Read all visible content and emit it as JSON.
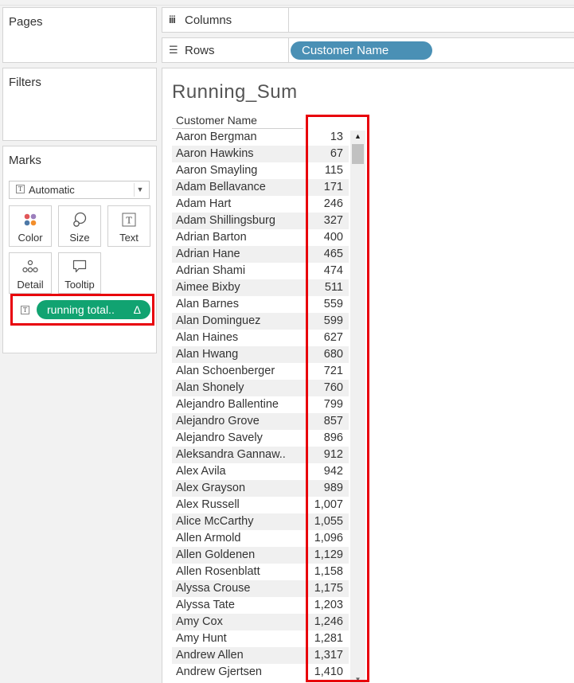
{
  "cards": {
    "pages_title": "Pages",
    "filters_title": "Filters",
    "marks_title": "Marks"
  },
  "marks": {
    "mark_type": "Automatic",
    "buttons": {
      "color": "Color",
      "size": "Size",
      "text": "Text",
      "detail": "Detail",
      "tooltip": "Tooltip"
    },
    "pill_label": "running total..",
    "pill_delta": "Δ"
  },
  "shelves": {
    "columns_label": "Columns",
    "rows_label": "Rows",
    "rows_pill": "Customer Name"
  },
  "view": {
    "title": "Running_Sum",
    "column_header": "Customer Name",
    "rows": [
      {
        "name": "Aaron Bergman",
        "value": "13"
      },
      {
        "name": "Aaron Hawkins",
        "value": "67"
      },
      {
        "name": "Aaron Smayling",
        "value": "115"
      },
      {
        "name": "Adam Bellavance",
        "value": "171"
      },
      {
        "name": "Adam Hart",
        "value": "246"
      },
      {
        "name": "Adam Shillingsburg",
        "value": "327"
      },
      {
        "name": "Adrian Barton",
        "value": "400"
      },
      {
        "name": "Adrian Hane",
        "value": "465"
      },
      {
        "name": "Adrian Shami",
        "value": "474"
      },
      {
        "name": "Aimee Bixby",
        "value": "511"
      },
      {
        "name": "Alan Barnes",
        "value": "559"
      },
      {
        "name": "Alan Dominguez",
        "value": "599"
      },
      {
        "name": "Alan Haines",
        "value": "627"
      },
      {
        "name": "Alan Hwang",
        "value": "680"
      },
      {
        "name": "Alan Schoenberger",
        "value": "721"
      },
      {
        "name": "Alan Shonely",
        "value": "760"
      },
      {
        "name": "Alejandro Ballentine",
        "value": "799"
      },
      {
        "name": "Alejandro Grove",
        "value": "857"
      },
      {
        "name": "Alejandro Savely",
        "value": "896"
      },
      {
        "name": "Aleksandra Gannaw..",
        "value": "912"
      },
      {
        "name": "Alex Avila",
        "value": "942"
      },
      {
        "name": "Alex Grayson",
        "value": "989"
      },
      {
        "name": "Alex Russell",
        "value": "1,007"
      },
      {
        "name": "Alice McCarthy",
        "value": "1,055"
      },
      {
        "name": "Allen Armold",
        "value": "1,096"
      },
      {
        "name": "Allen Goldenen",
        "value": "1,129"
      },
      {
        "name": "Allen Rosenblatt",
        "value": "1,158"
      },
      {
        "name": "Alyssa Crouse",
        "value": "1,175"
      },
      {
        "name": "Alyssa Tate",
        "value": "1,203"
      },
      {
        "name": "Amy Cox",
        "value": "1,246"
      },
      {
        "name": "Amy Hunt",
        "value": "1,281"
      },
      {
        "name": "Andrew Allen",
        "value": "1,317"
      },
      {
        "name": "Andrew Gjertsen",
        "value": "1,410"
      }
    ]
  },
  "colors": {
    "accent_green": "#11a371",
    "accent_blue": "#4a90b5",
    "highlight_red": "#e8000b"
  }
}
